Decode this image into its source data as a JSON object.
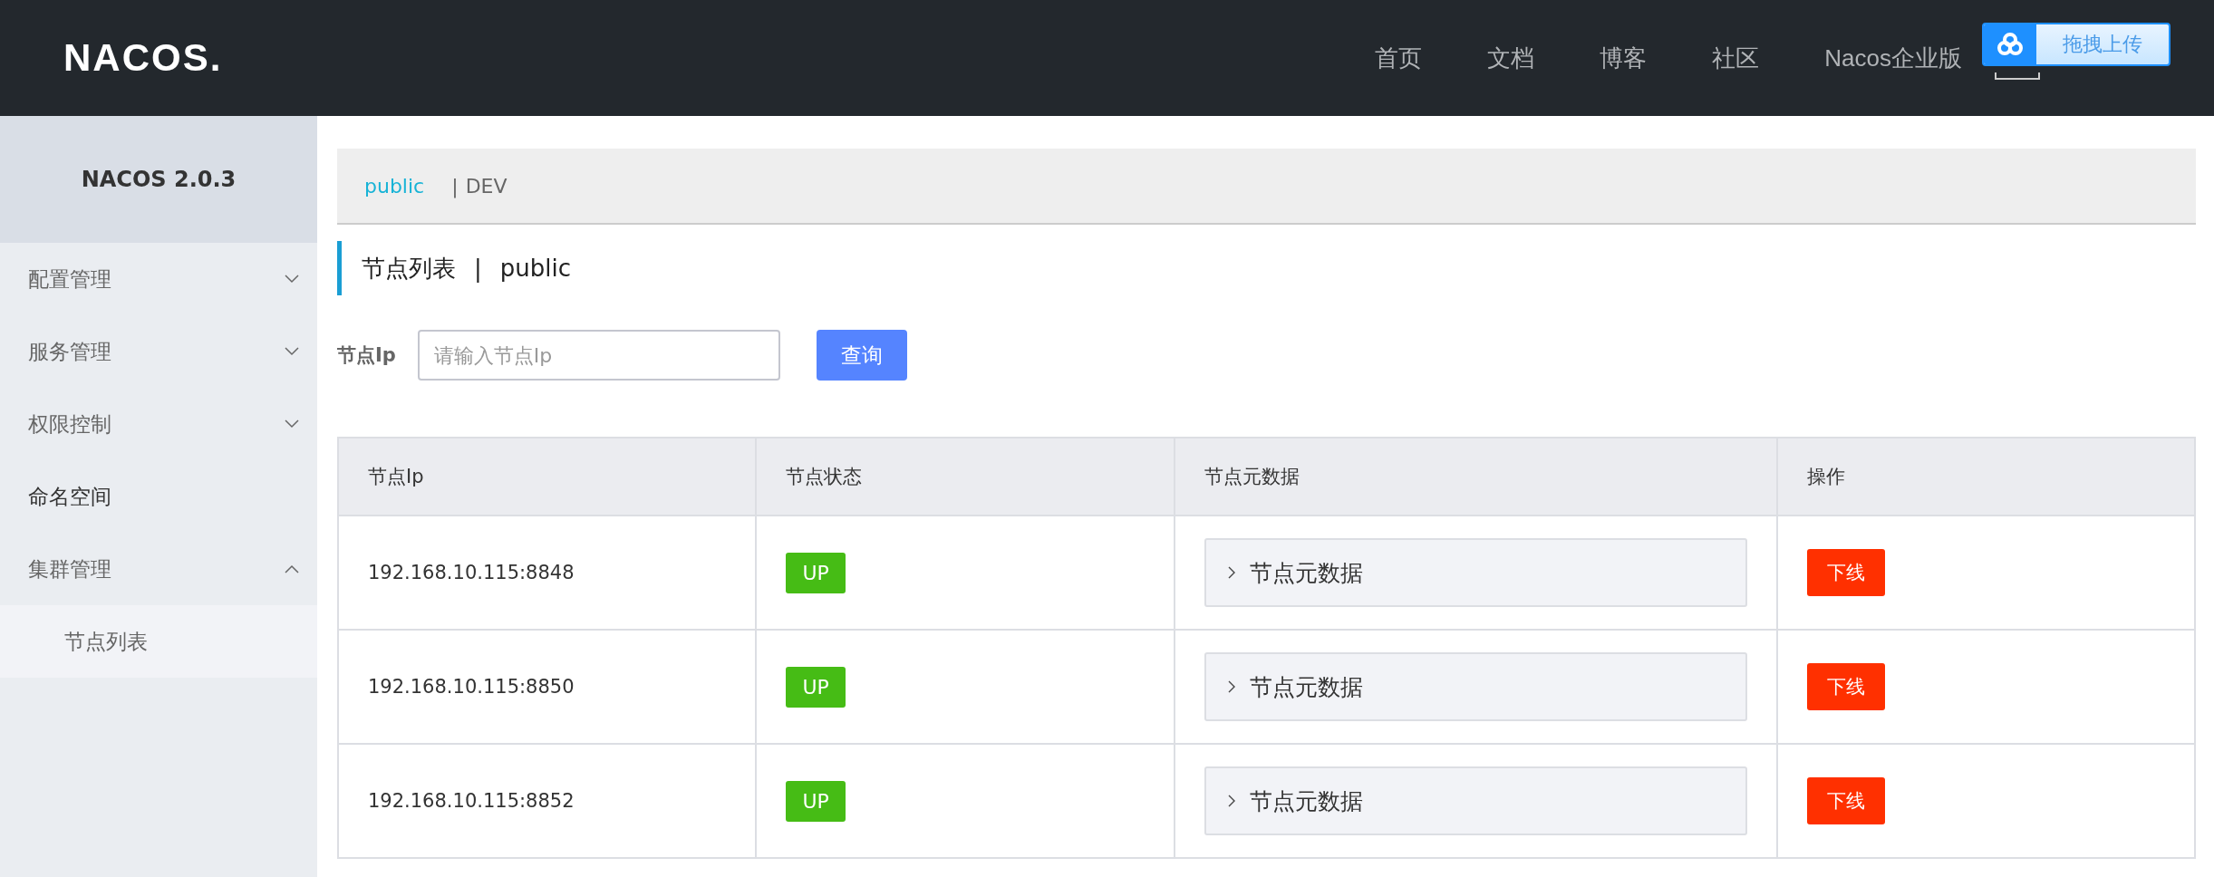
{
  "header": {
    "logo": "NACOS.",
    "nav": [
      {
        "label": "首页"
      },
      {
        "label": "文档"
      },
      {
        "label": "博客"
      },
      {
        "label": "社区"
      },
      {
        "label": "Nacos企业版"
      }
    ],
    "upload_widget": {
      "label": "拖拽上传"
    }
  },
  "sidebar": {
    "title": "NACOS 2.0.3",
    "items": [
      {
        "label": "配置管理",
        "expandable": true,
        "expanded": false
      },
      {
        "label": "服务管理",
        "expandable": true,
        "expanded": false
      },
      {
        "label": "权限控制",
        "expandable": true,
        "expanded": false
      },
      {
        "label": "命名空间",
        "expandable": false
      },
      {
        "label": "集群管理",
        "expandable": true,
        "expanded": true,
        "children": [
          {
            "label": "节点列表",
            "selected": true
          }
        ]
      }
    ]
  },
  "namespace_separator": "|",
  "namespaces": [
    {
      "label": "public",
      "selected": true
    },
    {
      "label": "DEV",
      "selected": false
    }
  ],
  "page_title": {
    "title": "节点列表",
    "separator": "|",
    "namespace": "public"
  },
  "search": {
    "label": "节点Ip",
    "placeholder": "请输入节点Ip",
    "button": "查询"
  },
  "table": {
    "columns": [
      "节点Ip",
      "节点状态",
      "节点元数据",
      "操作"
    ],
    "rows": [
      {
        "ip": "192.168.10.115:8848",
        "status": "UP",
        "metadata": "节点元数据",
        "action": "下线"
      },
      {
        "ip": "192.168.10.115:8850",
        "status": "UP",
        "metadata": "节点元数据",
        "action": "下线"
      },
      {
        "ip": "192.168.10.115:8852",
        "status": "UP",
        "metadata": "节点元数据",
        "action": "下线"
      }
    ]
  }
}
